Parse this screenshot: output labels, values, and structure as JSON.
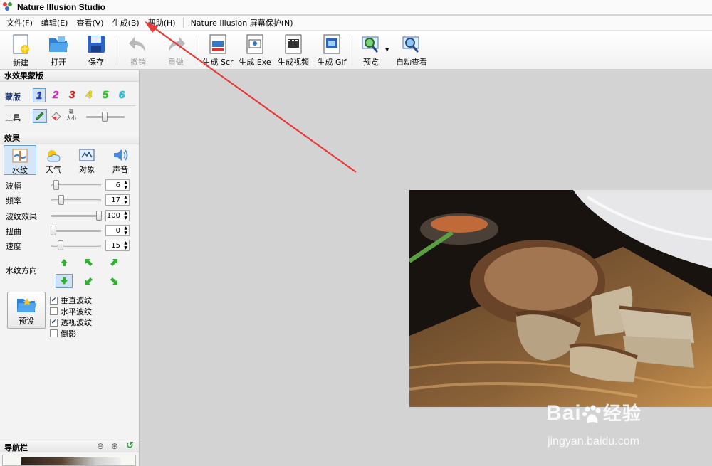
{
  "window": {
    "title": "Nature Illusion Studio"
  },
  "menu": [
    {
      "label": "文件(F)"
    },
    {
      "label": "编辑(E)"
    },
    {
      "label": "查看(V)"
    },
    {
      "label": "生成(B)"
    },
    {
      "label": "帮助(H)"
    },
    {
      "label": "Nature Illusion 屏幕保护(N)"
    }
  ],
  "toolbar": {
    "new": "新建",
    "open": "打开",
    "save": "保存",
    "undo": "撤销",
    "redo": "重做",
    "gen_scr": "生成 Scr",
    "gen_exe": "生成 Exe",
    "gen_video": "生成视频",
    "gen_gif": "生成 Gif",
    "preview": "预览",
    "auto_view": "自动查看"
  },
  "water_mask": {
    "title": "水效果蒙版",
    "mask_label": "蒙版",
    "masks": [
      {
        "label": "1",
        "color": "#1a3fd0"
      },
      {
        "label": "2",
        "color": "#e020d0"
      },
      {
        "label": "3",
        "color": "#e01818"
      },
      {
        "label": "4",
        "color": "#f0e000"
      },
      {
        "label": "5",
        "color": "#20d020"
      },
      {
        "label": "6",
        "color": "#10d0e8"
      }
    ],
    "tool_label": "工具",
    "size_label_top": "毫",
    "size_label_bottom": "大小",
    "brush_size": 0.45
  },
  "effects": {
    "title": "效果",
    "tabs": [
      {
        "label": "水纹",
        "active": true
      },
      {
        "label": "天气",
        "active": false
      },
      {
        "label": "对象",
        "active": false
      },
      {
        "label": "声音",
        "active": false
      }
    ],
    "params": [
      {
        "label": "波幅",
        "value": "6",
        "fraction": 0.06
      },
      {
        "label": "频率",
        "value": "17",
        "fraction": 0.17
      },
      {
        "label": "波纹效果",
        "value": "100",
        "fraction": 1.0
      },
      {
        "label": "扭曲",
        "value": "0",
        "fraction": 0.0
      },
      {
        "label": "速度",
        "value": "15",
        "fraction": 0.15
      }
    ],
    "direction_label": "水纹方向",
    "preset_label": "预设",
    "options": [
      {
        "label": "垂直波纹",
        "checked": true
      },
      {
        "label": "水平波纹",
        "checked": false
      },
      {
        "label": "透视波纹",
        "checked": true
      },
      {
        "label": "倒影",
        "checked": false
      }
    ]
  },
  "navigator": {
    "title": "导航栏"
  },
  "watermark": {
    "brand": "Bai",
    "brand2": "经验",
    "url": "jingyan.baidu.com"
  }
}
